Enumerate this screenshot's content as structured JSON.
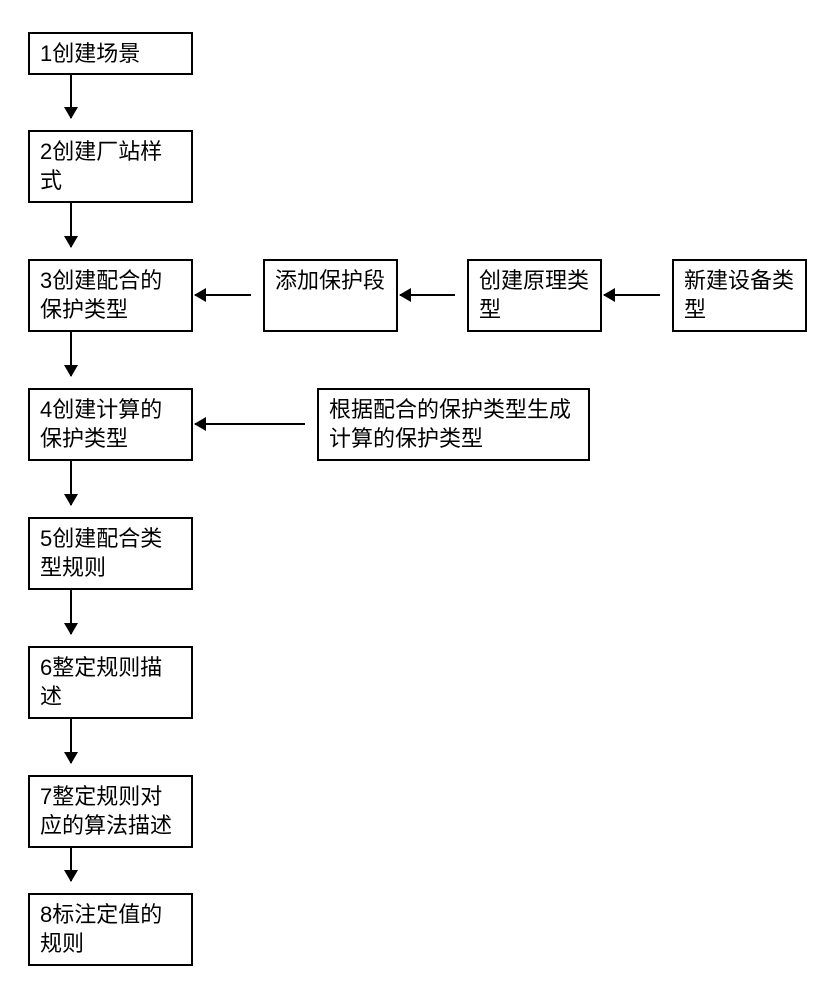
{
  "chart_data": {
    "type": "flowchart",
    "main_sequence": [
      "1创建场景",
      "2创建厂站样式",
      "3创建配合的保护类型",
      "4创建计算的保护类型",
      "5创建配合类型规则",
      "6整定规则描述",
      "7整定规则对应的算法描述",
      "8标注定值的规则"
    ],
    "side_inputs_to_step3": [
      "添加保护段",
      "创建原理类型",
      "新建设备类型"
    ],
    "side_input_to_step4": "根据配合的保护类型生成计算的保护类型"
  },
  "boxes": {
    "step1": "1创建场景",
    "step2": "2创建厂站样式",
    "step3": "3创建配合的保护类型",
    "step4": "4创建计算的保护类型",
    "step5": "5创建配合类型规则",
    "step6": "6整定规则描述",
    "step7": "7整定规则对应的算法描述",
    "step8": "8标注定值的规则",
    "side3a": "添加保护段",
    "side3b": "创建原理类型",
    "side3c": "新建设备类型",
    "side4": "根据配合的保护类型生成计算的保护类型"
  }
}
